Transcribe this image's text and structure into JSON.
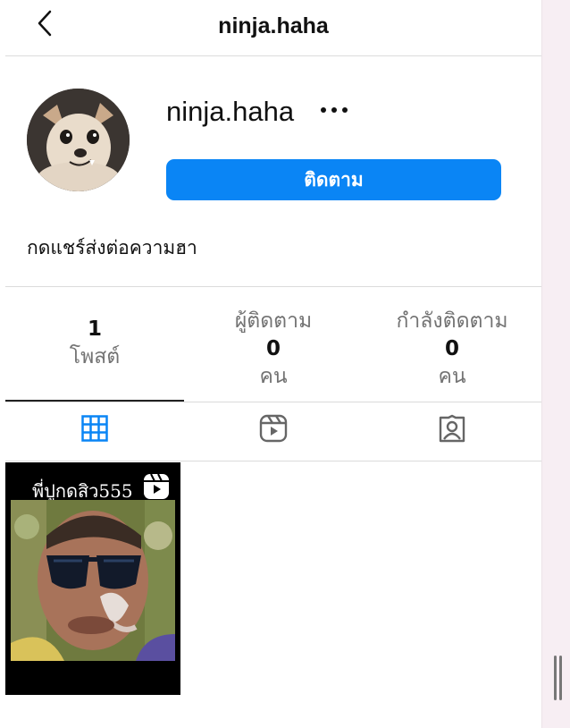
{
  "header": {
    "title": "ninja.haha",
    "back_icon": "chevron-left-icon"
  },
  "profile": {
    "username": "ninja.haha",
    "more_icon": "more-horizontal-icon",
    "follow_label": "ติดตาม",
    "bio": "กดแชร์ส่งต่อความฮา"
  },
  "stats": [
    {
      "label": "",
      "value": "1",
      "unit": "โพสต์"
    },
    {
      "label": "ผู้ติดตาม",
      "value": "0",
      "unit": "คน"
    },
    {
      "label": "กำลังติดตาม",
      "value": "0",
      "unit": "คน"
    }
  ],
  "tabs": [
    {
      "icon": "grid-icon",
      "active": true
    },
    {
      "icon": "reels-icon",
      "active": false
    },
    {
      "icon": "tagged-icon",
      "active": false
    }
  ],
  "posts": [
    {
      "caption": "พี่ปูกดสิว555",
      "badge_icon": "reel-badge-icon"
    }
  ],
  "colors": {
    "accent": "#0a85f5",
    "muted_text": "#737373",
    "divider": "#dbdbdb"
  }
}
